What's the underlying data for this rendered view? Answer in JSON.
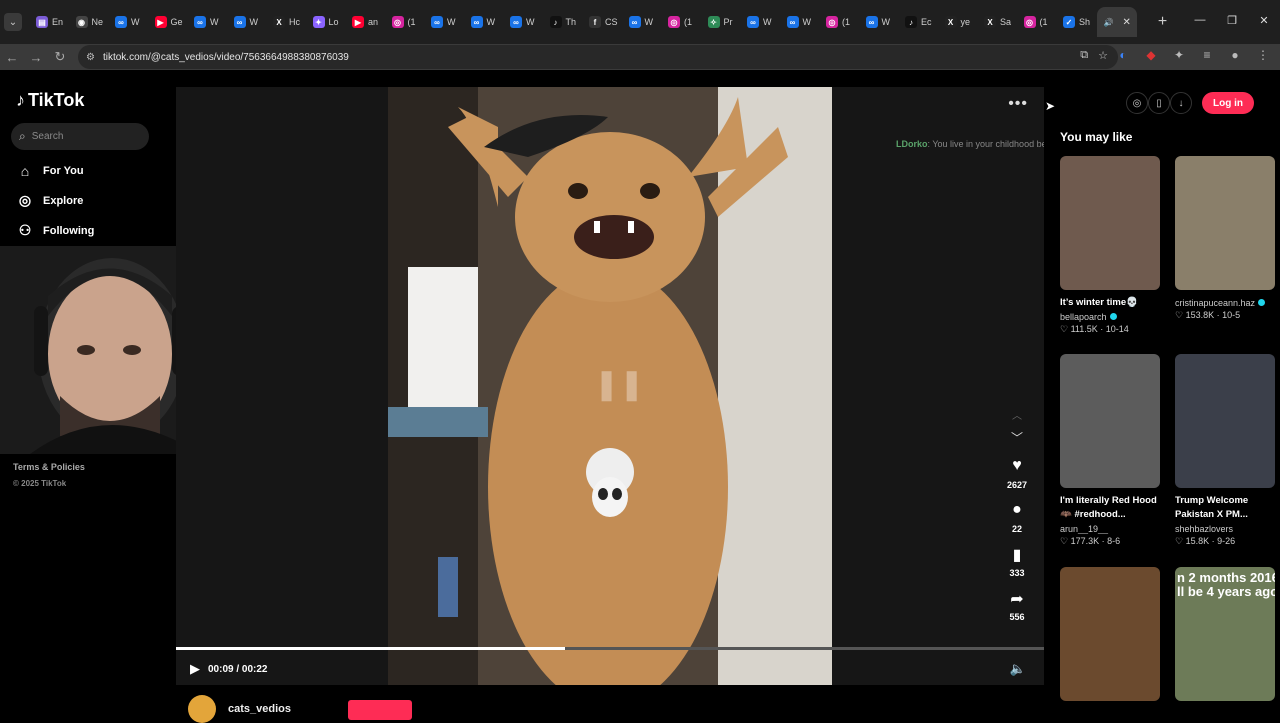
{
  "browser": {
    "tabs": [
      {
        "label": "En",
        "icon": "docs-icon",
        "color": "#7b5cd6"
      },
      {
        "label": "Ne",
        "icon": "github-icon",
        "color": "#444444"
      },
      {
        "label": "W",
        "icon": "chatgpt-icon",
        "color": "#1a73e8"
      },
      {
        "label": "Ge",
        "icon": "youtube-icon",
        "color": "#ff0033"
      },
      {
        "label": "W",
        "icon": "chatgpt-icon",
        "color": "#1a73e8"
      },
      {
        "label": "W",
        "icon": "chatgpt-icon",
        "color": "#1a73e8"
      },
      {
        "label": "Hc",
        "icon": "x-icon",
        "color": "#222222"
      },
      {
        "label": "Lo",
        "icon": "sparkle-icon",
        "color": "#8a63ff"
      },
      {
        "label": "an",
        "icon": "youtube-icon",
        "color": "#ff0033"
      },
      {
        "label": "(1",
        "icon": "instagram-icon",
        "color": "#d6249f"
      },
      {
        "label": "W",
        "icon": "chatgpt-icon",
        "color": "#1a73e8"
      },
      {
        "label": "W",
        "icon": "chatgpt-icon",
        "color": "#1a73e8"
      },
      {
        "label": "W",
        "icon": "chatgpt-icon",
        "color": "#1a73e8"
      },
      {
        "label": "Th",
        "icon": "tiktok-icon",
        "color": "#111111"
      },
      {
        "label": "CS",
        "icon": "f-icon",
        "color": "#333333"
      },
      {
        "label": "W",
        "icon": "chatgpt-icon",
        "color": "#1a73e8"
      },
      {
        "label": "(1",
        "icon": "instagram-icon",
        "color": "#d6249f"
      },
      {
        "label": "Pr",
        "icon": "leaf-icon",
        "color": "#2e8b57"
      },
      {
        "label": "W",
        "icon": "chatgpt-icon",
        "color": "#1a73e8"
      },
      {
        "label": "W",
        "icon": "chatgpt-icon",
        "color": "#1a73e8"
      },
      {
        "label": "(1",
        "icon": "instagram-icon",
        "color": "#d6249f"
      },
      {
        "label": "W",
        "icon": "chatgpt-icon",
        "color": "#1a73e8"
      },
      {
        "label": "Ec",
        "icon": "tiktok-icon",
        "color": "#111111"
      },
      {
        "label": "ye",
        "icon": "x-icon",
        "color": "#222222"
      },
      {
        "label": "Sa",
        "icon": "x-icon",
        "color": "#222222"
      },
      {
        "label": "(1",
        "icon": "instagram-icon",
        "color": "#d6249f"
      },
      {
        "label": "Sh",
        "icon": "check-icon",
        "color": "#1a73e8"
      }
    ],
    "new_tab": "+",
    "url": "tiktok.com/@cats_vedios/video/7563664988380876039"
  },
  "sidebar": {
    "logo": "TikTok",
    "search_placeholder": "Search",
    "nav": [
      {
        "label": "For You",
        "icon": "home-icon"
      },
      {
        "label": "Explore",
        "icon": "compass-icon"
      },
      {
        "label": "Following",
        "icon": "following-icon"
      }
    ],
    "footer_terms": "Terms & Policies",
    "footer_copy": "© 2025 TikTok"
  },
  "player": {
    "overlay_comment_user": "LDorko",
    "overlay_comment_text": ": You live in your childhood bedroom... You aint investing shit",
    "likes": "2627",
    "comments": "22",
    "saves": "333",
    "shares": "556",
    "time": "00:09 / 00:22",
    "progress": 0.448,
    "author": "cats_vedios"
  },
  "header": {
    "login": "Log in"
  },
  "recommendations": {
    "heading": "You may like",
    "items": [
      {
        "title": "It’s winter time💀",
        "user": "bellapoarch",
        "verified": true,
        "likes": "111.5K",
        "date": "10-14",
        "thumb_color": "#6f5a4e"
      },
      {
        "title": "",
        "user": "cristinapuceann.haz",
        "verified": true,
        "likes": "153.8K",
        "date": "10-5",
        "thumb_color": "#8a7f6a"
      },
      {
        "title": "I'm literally Red Hood 🦇 #redhood...",
        "user": "arun__19__",
        "verified": false,
        "likes": "177.3K",
        "date": "8-6",
        "thumb_color": "#5c5c5c"
      },
      {
        "title": "Trump Welcome Pakistan X PM...",
        "user": "shehbazlovers",
        "verified": false,
        "likes": "15.8K",
        "date": "9-26",
        "thumb_color": "#3b3f4a"
      },
      {
        "title": "",
        "user": "",
        "verified": false,
        "likes": "",
        "date": "",
        "thumb_color": "#6b4a2e"
      },
      {
        "title": "",
        "user": "",
        "verified": false,
        "likes": "",
        "date": "",
        "thumb_color": "#6d7b58",
        "thumb_text": "n 2 months 2016\nll be 4 years ago"
      }
    ]
  }
}
